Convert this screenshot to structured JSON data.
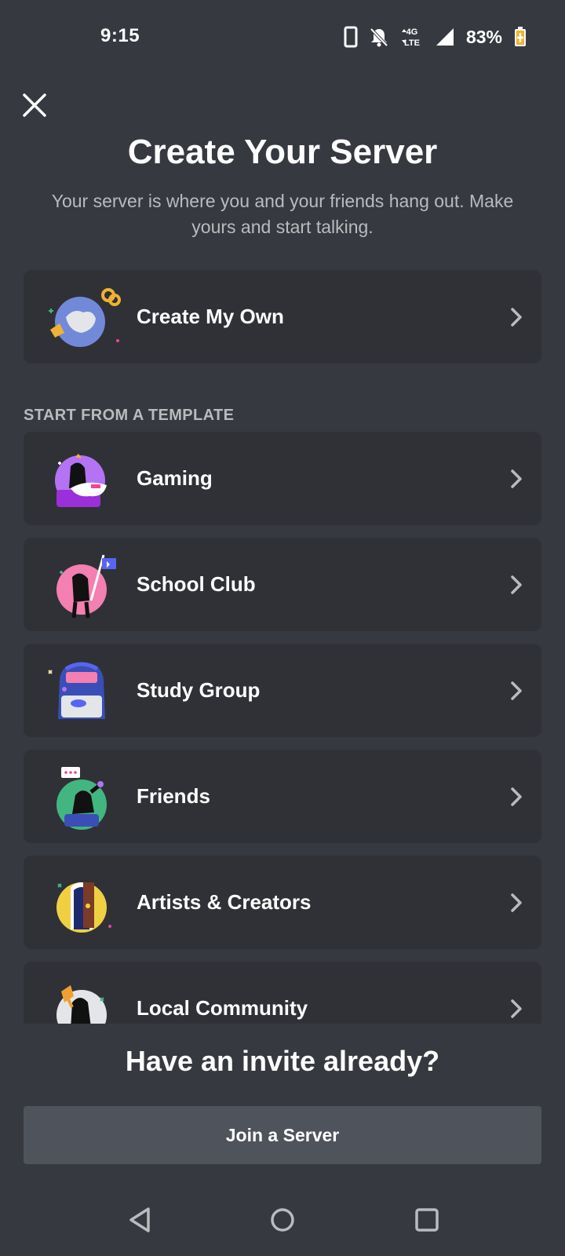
{
  "status_bar": {
    "time": "9:15",
    "network": "4G LTE",
    "battery": "83%",
    "icons": [
      "phone-icon",
      "bell-off-icon",
      "signal-icon",
      "battery-icon"
    ]
  },
  "header": {
    "close_icon": "close-icon",
    "title": "Create Your Server",
    "subtitle": "Your server is where you and your friends hang out. Make yours and start talking."
  },
  "create_own": {
    "label": "Create My Own",
    "icon": "create-own-icon"
  },
  "templates": {
    "section_header": "START FROM A TEMPLATE",
    "items": [
      {
        "label": "Gaming",
        "icon": "gaming-icon"
      },
      {
        "label": "School Club",
        "icon": "school-club-icon"
      },
      {
        "label": "Study Group",
        "icon": "study-group-icon"
      },
      {
        "label": "Friends",
        "icon": "friends-icon"
      },
      {
        "label": "Artists & Creators",
        "icon": "artists-creators-icon"
      },
      {
        "label": "Local Community",
        "icon": "local-community-icon"
      }
    ]
  },
  "invite": {
    "heading": "Have an invite already?",
    "button_label": "Join a Server"
  },
  "nav_bar": {
    "items": [
      "back-icon",
      "home-icon",
      "recents-icon"
    ]
  },
  "colors": {
    "background": "#36393f",
    "card": "#2f3136",
    "muted_text": "#b9bbbe",
    "button": "#4f545c",
    "blurple": "#5865f2"
  }
}
